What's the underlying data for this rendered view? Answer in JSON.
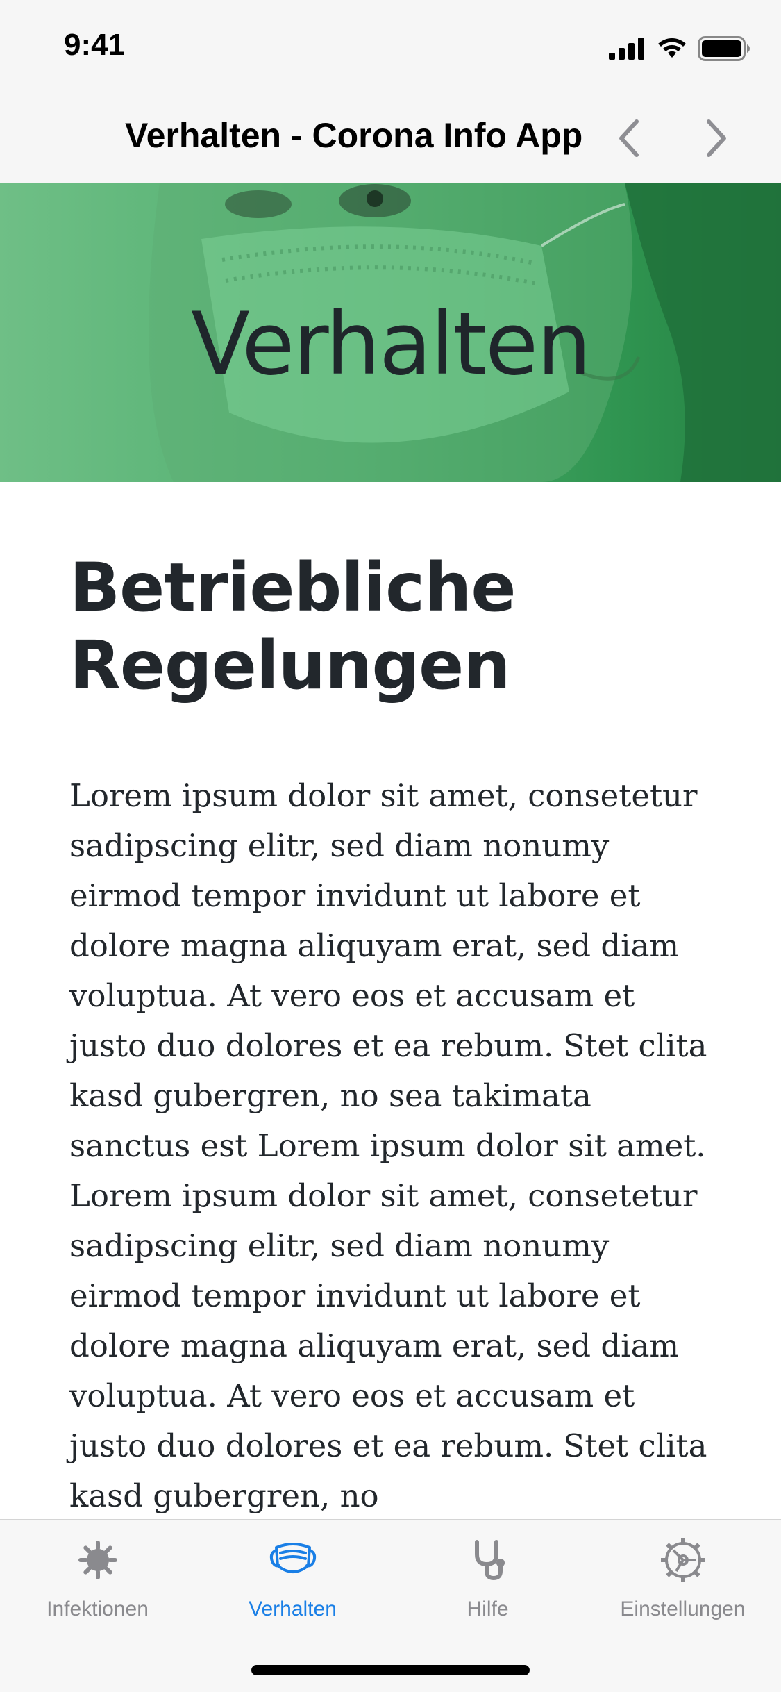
{
  "status_bar": {
    "time": "9:41"
  },
  "nav": {
    "title": "Verhalten - Corona Info App",
    "back_icon": "chevron-left-icon",
    "forward_icon": "chevron-right-icon"
  },
  "hero": {
    "title": "Verhalten"
  },
  "content": {
    "heading_line1": "Betriebliche",
    "heading_line2": "Regelungen",
    "body": "Lorem ipsum dolor sit amet, consetetur sadipscing elitr, sed diam nonumy eirmod tempor invidunt ut labore et dolore magna aliquyam erat, sed diam voluptua. At vero eos et accusam et justo duo dolores et ea rebum. Stet clita kasd gubergren, no sea takimata sanctus est Lorem ipsum dolor sit amet. Lorem ipsum dolor sit amet, consetetur sadipscing elitr, sed diam nonumy eirmod tempor invidunt ut labore et dolore magna aliquyam erat, sed diam voluptua. At vero eos et accusam et justo duo dolores et ea rebum. Stet clita kasd gubergren, no"
  },
  "tabs": [
    {
      "label": "Infektionen",
      "icon": "virus-icon",
      "active": false
    },
    {
      "label": "Verhalten",
      "icon": "mask-icon",
      "active": true
    },
    {
      "label": "Hilfe",
      "icon": "stethoscope-icon",
      "active": false
    },
    {
      "label": "Einstellungen",
      "icon": "gear-icon",
      "active": false
    }
  ],
  "colors": {
    "accent": "#1a7fe6",
    "hero_green": "#4fae6e",
    "tab_inactive": "#8a8a8e"
  }
}
